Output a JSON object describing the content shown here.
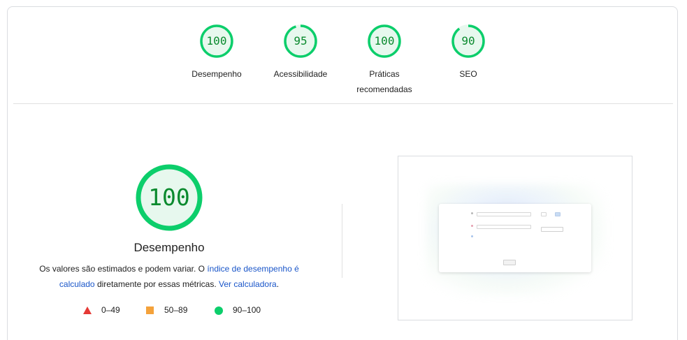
{
  "categories": [
    {
      "score": "100",
      "label": "Desempenho",
      "value": 100
    },
    {
      "score": "95",
      "label": "Acessibilidade",
      "value": 95
    },
    {
      "score": "100",
      "label": "Práticas recomendadas",
      "label_line1": "Práticas",
      "label_line2": "recomendadas",
      "value": 100
    },
    {
      "score": "90",
      "label": "SEO",
      "value": 90
    }
  ],
  "performance": {
    "score": "100",
    "value": 100,
    "title": "Desempenho",
    "desc_part1": "Os valores são estimados e podem variar. O ",
    "desc_link1": "índice de desempenho é calculado",
    "desc_part2": " diretamente por essas métricas. ",
    "desc_link2": "Ver calculadora",
    "desc_part3": "."
  },
  "legend": [
    {
      "range": "0–49",
      "shape": "triangle",
      "color": "#e53935"
    },
    {
      "range": "50–89",
      "shape": "square",
      "color": "#f4a23b"
    },
    {
      "range": "90–100",
      "shape": "circle",
      "color": "#0cce6b"
    }
  ],
  "colors": {
    "pass": "#0cce6b",
    "pass_text": "#0a8a2e",
    "pass_fill": "#e7f8ee",
    "link": "#1a56c9"
  }
}
